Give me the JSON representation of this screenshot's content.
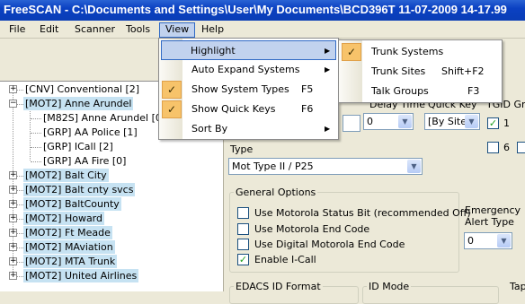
{
  "window": {
    "title": "FreeSCAN - C:\\Documents and Settings\\User\\My Documents\\BCD396T 11-07-2009 14-17.99"
  },
  "menubar": [
    "File",
    "Edit",
    "Scanner",
    "Tools",
    "View",
    "Help"
  ],
  "view_menu": {
    "items": [
      {
        "label": "Highlight",
        "shortcut": "",
        "checked": false,
        "submenu": true
      },
      {
        "label": "Auto Expand Systems",
        "shortcut": "",
        "checked": false,
        "submenu": true
      },
      {
        "label": "Show System Types",
        "shortcut": "F5",
        "checked": true,
        "submenu": false
      },
      {
        "label": "Show Quick Keys",
        "shortcut": "F6",
        "checked": true,
        "submenu": false
      },
      {
        "label": "Sort By",
        "shortcut": "",
        "checked": false,
        "submenu": true
      }
    ]
  },
  "highlight_submenu": {
    "items": [
      {
        "label": "Trunk Systems",
        "shortcut": "",
        "checked": true
      },
      {
        "label": "Trunk Sites",
        "shortcut": "Shift+F2",
        "checked": false
      },
      {
        "label": "Talk Groups",
        "shortcut": "F3",
        "checked": false
      }
    ]
  },
  "tree": {
    "nodes": [
      {
        "label": "[CNV] Conventional [2]",
        "level": 0,
        "expander": "+",
        "highlighted": false
      },
      {
        "label": "[MOT2] Anne Arundel",
        "level": 0,
        "expander": "-",
        "highlighted": true
      },
      {
        "label": "[M82S] Anne Arundel [0]",
        "level": 1,
        "expander": "",
        "highlighted": false
      },
      {
        "label": "[GRP] AA Police [1]",
        "level": 1,
        "expander": "",
        "highlighted": false
      },
      {
        "label": "[GRP] ICall [2]",
        "level": 1,
        "expander": "",
        "highlighted": false
      },
      {
        "label": "[GRP] AA Fire [0]",
        "level": 1,
        "expander": "",
        "highlighted": false
      },
      {
        "label": "[MOT2] Balt City",
        "level": 0,
        "expander": "+",
        "highlighted": true
      },
      {
        "label": "[MOT2] Balt cnty svcs",
        "level": 0,
        "expander": "+",
        "highlighted": true
      },
      {
        "label": "[MOT2] BaltCounty",
        "level": 0,
        "expander": "+",
        "highlighted": true
      },
      {
        "label": "[MOT2] Howard",
        "level": 0,
        "expander": "+",
        "highlighted": true
      },
      {
        "label": "[MOT2] Ft Meade",
        "level": 0,
        "expander": "+",
        "highlighted": true
      },
      {
        "label": "[MOT2] MAviation",
        "level": 0,
        "expander": "+",
        "highlighted": true
      },
      {
        "label": "[MOT2] MTA Trunk",
        "level": 0,
        "expander": "+",
        "highlighted": true
      },
      {
        "label": "[MOT2] United Airlines",
        "level": 0,
        "expander": "+",
        "highlighted": true
      }
    ]
  },
  "panel": {
    "delay_time_label": "Delay Time",
    "quick_key_label": "Quick Key",
    "tgid_group_label": "TGID Grou",
    "delay_value": "0",
    "quick_key_value": "[By Site]",
    "tgid_1": "1",
    "tgid_6": "6",
    "type_label": "Type",
    "type_value": "Mot Type II / P25",
    "general_options_title": "General Options",
    "options": [
      {
        "label": "Use Motorola Status Bit (recommended Off)",
        "checked": false
      },
      {
        "label": "Use Motorola End Code",
        "checked": false
      },
      {
        "label": "Use Digital  Motorola End Code",
        "checked": false
      },
      {
        "label": "Enable I-Call",
        "checked": true
      }
    ],
    "emergency_label_1": "Emergency",
    "emergency_label_2": "Alert Type",
    "emergency_value": "0",
    "edacs_label": "EDACS ID Format",
    "id_mode_label": "ID Mode",
    "tap_label": "Tap"
  },
  "colors": {
    "title_bar": "#0b41c2",
    "highlight": "#c6e2f2",
    "menu_hover": "#c1d2ee",
    "check_bg": "#f7c36a"
  }
}
